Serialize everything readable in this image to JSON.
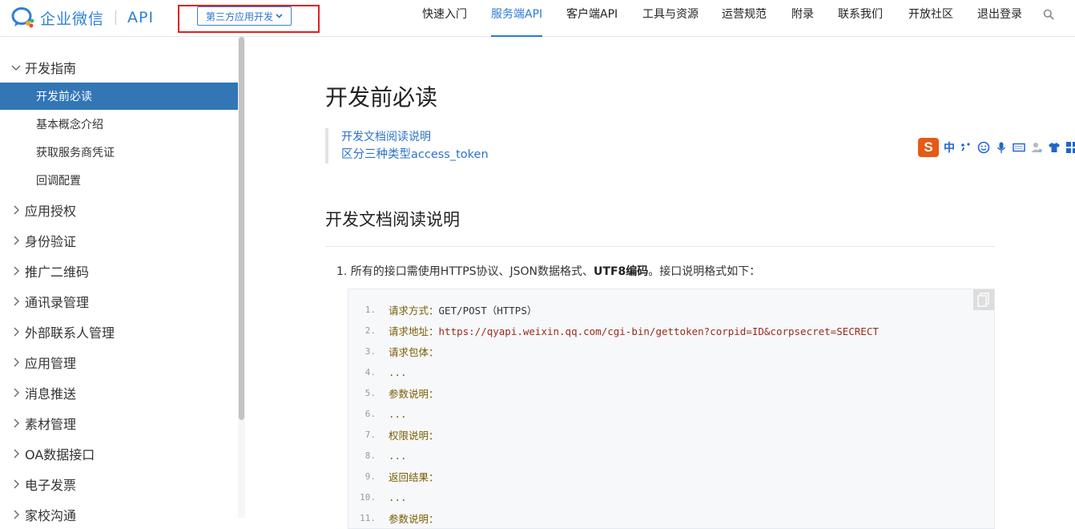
{
  "header": {
    "logo_text": "企业微信",
    "logo_api": "API",
    "type_dropdown": "第三方应用开发",
    "nav": [
      {
        "label": "快速入门"
      },
      {
        "label": "服务端API"
      },
      {
        "label": "客户端API"
      },
      {
        "label": "工具与资源"
      },
      {
        "label": "运营规范"
      },
      {
        "label": "附录"
      },
      {
        "label": "联系我们"
      },
      {
        "label": "开放社区"
      },
      {
        "label": "退出登录"
      }
    ],
    "active_nav": "服务端API"
  },
  "sidebar": {
    "top_group": "开发指南",
    "sub_items": [
      "开发前必读",
      "基本概念介绍",
      "获取服务商凭证",
      "回调配置"
    ],
    "active_sub": "开发前必读",
    "groups": [
      "应用授权",
      "身份验证",
      "推广二维码",
      "通讯录管理",
      "外部联系人管理",
      "应用管理",
      "消息推送",
      "素材管理",
      "OA数据接口",
      "电子发票",
      "家校沟通"
    ]
  },
  "main": {
    "title": "开发前必读",
    "toc": [
      "开发文档阅读说明",
      "区分三种类型access_token"
    ],
    "section_title": "开发文档阅读说明",
    "para_prefix": "1. 所有的接口需使用HTTPS协议、JSON数据格式、",
    "para_bold": "UTF8编码",
    "para_suffix": "。接口说明格式如下：",
    "code_lines": [
      {
        "n": "1.",
        "label": "请求方式：",
        "value": "GET/POST（HTTPS）"
      },
      {
        "n": "2.",
        "label": "请求地址：",
        "value": "https://qyapi.weixin.qq.com/cgi-bin/gettoken?corpid=ID&corpsecret=SECRECT"
      },
      {
        "n": "3.",
        "label": "请求包体：",
        "value": ""
      },
      {
        "n": "4.",
        "label": "...",
        "value": ""
      },
      {
        "n": "5.",
        "label": "参数说明：",
        "value": ""
      },
      {
        "n": "6.",
        "label": "...",
        "value": ""
      },
      {
        "n": "7.",
        "label": "权限说明：",
        "value": ""
      },
      {
        "n": "8.",
        "label": "...",
        "value": ""
      },
      {
        "n": "9.",
        "label": "返回结果：",
        "value": ""
      },
      {
        "n": "10.",
        "label": "...",
        "value": ""
      },
      {
        "n": "11.",
        "label": "参数说明：",
        "value": ""
      }
    ]
  },
  "ime": {
    "logo": "S",
    "lang": "中",
    "icons": [
      "punctuation-icon",
      "emoji-icon",
      "microphone-icon",
      "keyboard-icon",
      "user-icon",
      "skin-icon",
      "grid-icon"
    ]
  },
  "colors": {
    "accent": "#2b7cd3",
    "sidebar_active": "#3276b6",
    "highlight_box": "#e02020",
    "ime_orange": "#e55a14"
  }
}
